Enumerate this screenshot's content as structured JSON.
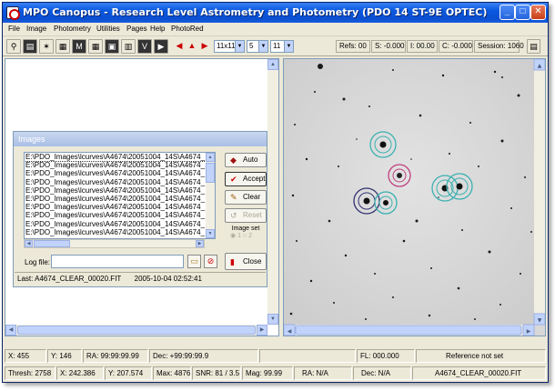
{
  "window": {
    "title": "MPO Canopus - Research Level Astrometry and Photometry (PDO 14 ST-9E OPTEC)"
  },
  "menu": [
    "File",
    "Image",
    "Photometry",
    "Utilities",
    "Pages",
    "Help",
    "PhotoRed"
  ],
  "toolbar": {
    "aperture_select": "11x11",
    "gap_select": "5",
    "annulus_select": "11",
    "refs": "Refs: 00",
    "s_value": "S: -0.000",
    "i_value": "I: 00.00",
    "c_value": "C: -0.000",
    "session": "Session: 1060"
  },
  "images_panel": {
    "title": "Images",
    "files": [
      "E:\\PDO_Images\\lcurves\\A4674\\20051004_14S\\A4674_",
      "E:\\PDO_Images\\lcurves\\A4674\\20051004_14S\\A4674_",
      "E:\\PDO_Images\\lcurves\\A4674\\20051004_14S\\A4674_",
      "E:\\PDO_Images\\lcurves\\A4674\\20051004_14S\\A4674_",
      "E:\\PDO_Images\\lcurves\\A4674\\20051004_14S\\A4674_",
      "E:\\PDO_Images\\lcurves\\A4674\\20051004_14S\\A4674_",
      "E:\\PDO_Images\\lcurves\\A4674\\20051004_14S\\A4674_",
      "E:\\PDO_Images\\lcurves\\A4674\\20051004_14S\\A4674_",
      "E:\\PDO_Images\\lcurves\\A4674\\20051004_14S\\A4674_",
      "E:\\PDO_Images\\lcurves\\A4674\\20051004_14S\\A4674_"
    ],
    "buttons": {
      "auto": "Auto",
      "accept": "Accept",
      "clear": "Clear",
      "reset": "Reset",
      "close": "Close"
    },
    "image_set_label": "Image set",
    "image_set_options": [
      "1",
      "2"
    ],
    "log_file_label": "Log file:",
    "log_file_value": "",
    "last_label": "Last: A4674_CLEAR_00020.FIT",
    "last_timestamp": "2005-10-04  02:52:41"
  },
  "status_row1": {
    "x": "X: 455",
    "y": "Y: 146",
    "ra": "RA: 99:99:99.99",
    "dec": "Dec: +99:99:99.9",
    "fl": "FL: 000.000",
    "reference": "Reference not set"
  },
  "status_row2": {
    "thresh": "Thresh: 2758",
    "x": "X: 242.386",
    "y": "Y: 207.574",
    "max": "Max: 4876",
    "snr": "SNR: 81 / 3.5",
    "mag": "Mag: 99.99",
    "ra": "RA: N/A",
    "dec": "Dec: N/A",
    "file": "A4674_CLEAR_00020.FIT"
  },
  "colors": {
    "title_bar": "#0a58e0",
    "aperture_cyan": "#3ab0b0",
    "aperture_magenta": "#c04080",
    "aperture_navy": "#303070"
  }
}
